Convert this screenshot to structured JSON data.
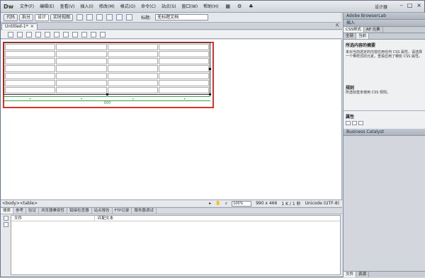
{
  "app": {
    "logo": "Dw"
  },
  "menu": [
    "文件(F)",
    "编辑(E)",
    "查看(V)",
    "插入(I)",
    "修改(M)",
    "格式(O)",
    "命令(C)",
    "站点(S)",
    "窗口(W)",
    "帮助(H)"
  ],
  "workspace": "设计器",
  "view_buttons": {
    "code": "代码",
    "split": "拆分",
    "design": "设计",
    "live": "实时视图"
  },
  "title_field": {
    "label": "标题:",
    "value": "无标题文档"
  },
  "document": {
    "tab_name": "Untitled-1*",
    "close": "×"
  },
  "table": {
    "rows": 7,
    "cols": 4,
    "width_label": "600"
  },
  "status": {
    "tag": "<body><table>",
    "zoom": "100%",
    "dimensions": "990 x 466",
    "size": "1 K / 1 秒",
    "encoding": "Unicode (UTF-8)"
  },
  "results": {
    "tabs": [
      "搜索",
      "参考",
      "验证",
      "浏览器兼容性",
      "链接检查器",
      "站点报告",
      "FTP记录",
      "服务器调试"
    ],
    "col_file": "文件",
    "col_match": "匹配文本"
  },
  "right_panel": {
    "browserlab": "Adobe BrowserLab",
    "insert": "插入",
    "css_tabs": [
      "CSS样式",
      "AP 元素"
    ],
    "css_subtabs": [
      "全部",
      "当前"
    ],
    "summary_title": "所选内容的摘要",
    "summary_text": "未对当前选定的内容应用任何 CSS 属性。请选择一个带样式的元素，查看应用了哪些 CSS 属性。",
    "rules_title": "规则",
    "rules_text": "所选标签未使用 CSS 规则。",
    "props_title": "属性",
    "catalyst": "Business Catalyst",
    "bottom_tabs": [
      "文件",
      "资源"
    ]
  }
}
